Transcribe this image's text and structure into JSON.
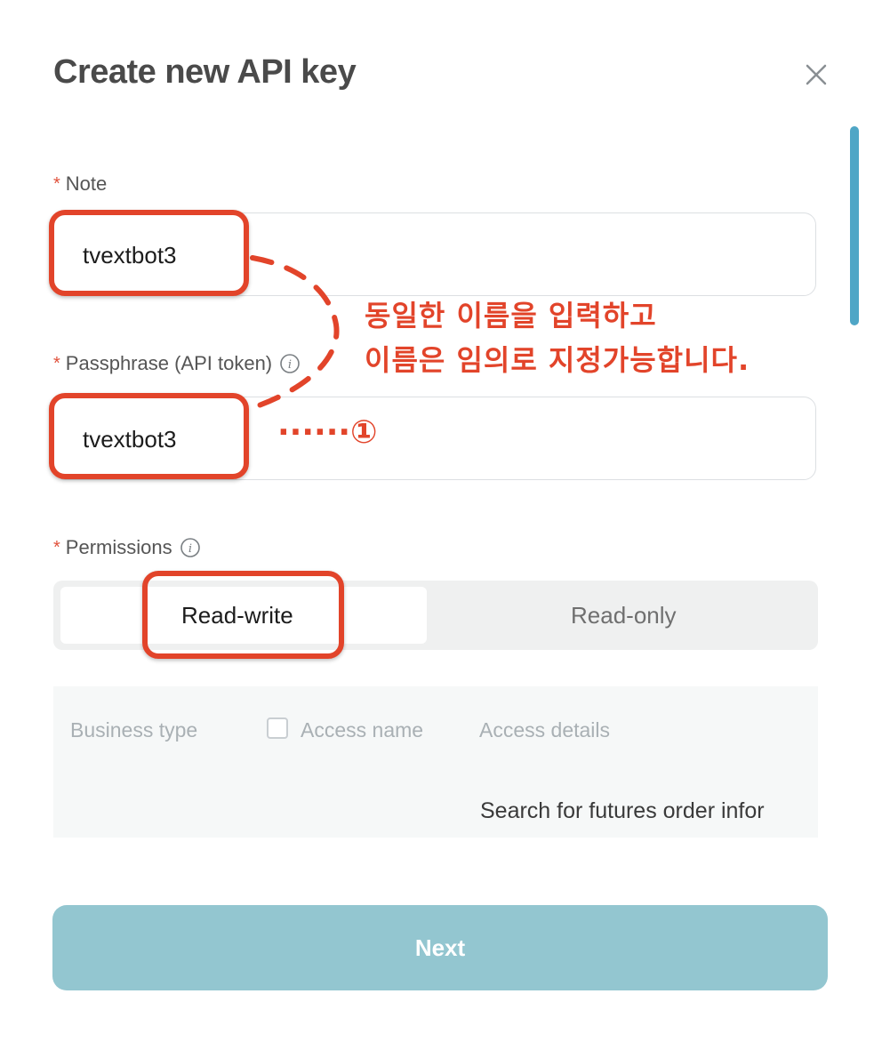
{
  "dialog": {
    "title": "Create new API key"
  },
  "note": {
    "label": "Note",
    "required_mark": "*",
    "value": "tvextbot3"
  },
  "passphrase": {
    "label": "Passphrase (API token)",
    "required_mark": "*",
    "value": "tvextbot3"
  },
  "permissions": {
    "label": "Permissions",
    "required_mark": "*",
    "options": [
      {
        "label": "Read-write",
        "selected": true
      },
      {
        "label": "Read-only",
        "selected": false
      }
    ]
  },
  "access_table": {
    "headers": [
      "Business type",
      "Access name",
      "Access details"
    ],
    "rows": [
      {
        "details": "Search for futures order infor"
      }
    ]
  },
  "footer": {
    "next_label": "Next"
  },
  "annotation": {
    "line1": "동일한 이름을 입력하고",
    "line2": "이름은 임의로 지정가능합니다.",
    "marker": "······①",
    "color": "#e2442a"
  },
  "colors": {
    "accent": "#4fa6c6",
    "next_button": "#93c6d0",
    "required": "#e0503a"
  },
  "icons": [
    "close-icon",
    "info-icon",
    "checkbox"
  ]
}
